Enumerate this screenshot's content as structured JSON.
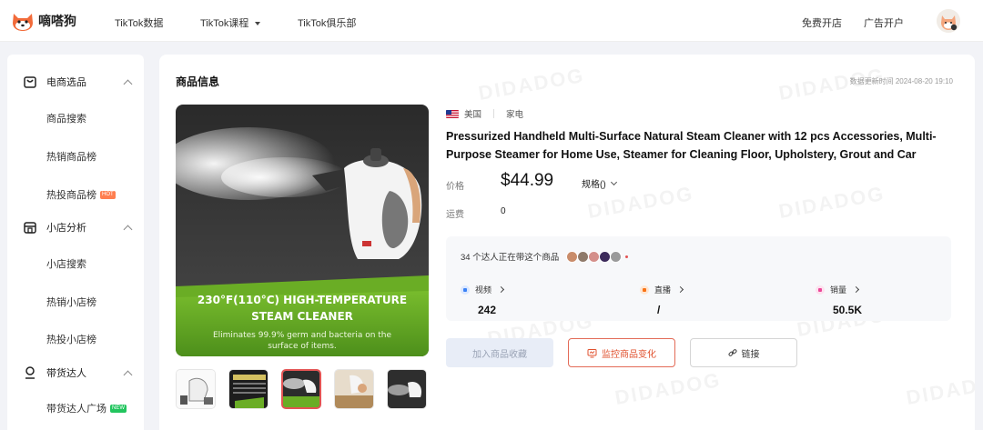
{
  "app": {
    "name": "嘀嗒狗"
  },
  "nav": {
    "items": [
      "TikTok数据",
      "TikTok课程",
      "TikTok俱乐部"
    ],
    "right": [
      "免费开店",
      "广告开户"
    ]
  },
  "sidebar": {
    "sections": [
      {
        "title": "电商选品",
        "icon": "cart-icon",
        "items": [
          "商品搜索",
          "热销商品榜",
          "热投商品榜"
        ]
      },
      {
        "title": "小店分析",
        "icon": "store-icon",
        "items": [
          "小店搜索",
          "热销小店榜",
          "热投小店榜"
        ]
      },
      {
        "title": "带货达人",
        "icon": "person-icon",
        "items": [
          "带货达人广场"
        ]
      }
    ],
    "badge_hot": "HOT",
    "badge_new": "NEW"
  },
  "product": {
    "panel_title": "商品信息",
    "update_time": "数据更新时间 2024-08-20 19:10",
    "country": "美国",
    "category": "家电",
    "title": "Pressurized Handheld Multi-Surface Natural Steam Cleaner with 12 pcs Accessories, Multi-Purpose Steamer for Home Use, Steamer for Cleaning Floor, Upholstery, Grout and Car",
    "price_label": "价格",
    "price": "$44.99",
    "spec_label": "规格()",
    "freight_label": "运费",
    "freight": "0",
    "image_caption_1": "230°F(110°C) HIGH-TEMPERATURE",
    "image_caption_2": "STEAM CLEANER",
    "image_caption_3": "Eliminates 99.9% germ and bacteria on the",
    "image_caption_4": "surface of items.",
    "creators_text": "34 个达人正在带这个商品",
    "stats": [
      {
        "label": "视频",
        "value": "242",
        "color": "#3b82f6"
      },
      {
        "label": "直播",
        "value": "/",
        "color": "#f97316"
      },
      {
        "label": "销量",
        "value": "50.5K",
        "color": "#ec4899"
      }
    ],
    "buttons": {
      "favorite": "加入商品收藏",
      "monitor": "监控商品变化",
      "link": "链接"
    },
    "watermark": "DIDADOG"
  }
}
